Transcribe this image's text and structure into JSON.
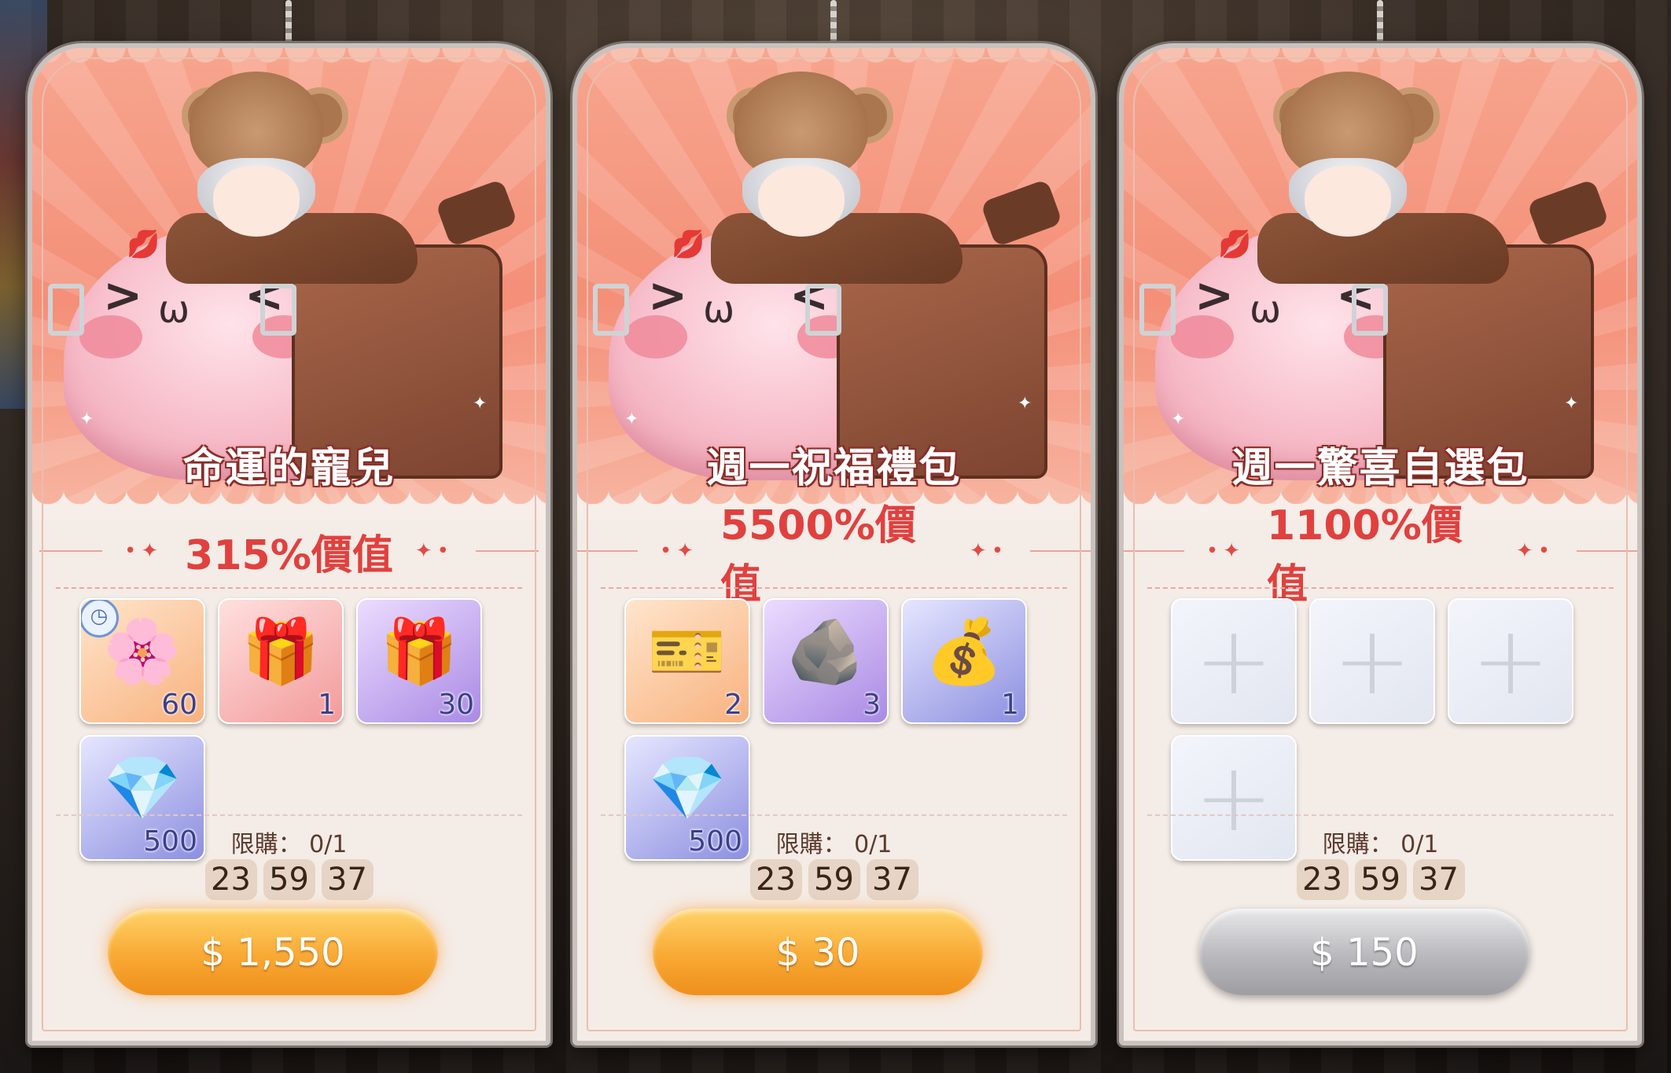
{
  "cards": [
    {
      "name": "命運的寵兒",
      "value": "315%價值",
      "items": [
        {
          "icon": "rose-petal-icon",
          "glyph": "🌸",
          "qty": "60",
          "timed": true,
          "bg": "orange"
        },
        {
          "icon": "gift-box-icon",
          "glyph": "🎁",
          "qty": "1",
          "bg": "pink"
        },
        {
          "icon": "gift-pile-icon",
          "glyph": "🎁",
          "qty": "30",
          "bg": "purple"
        },
        {
          "icon": "diamond-icon",
          "glyph": "💎",
          "qty": "500",
          "bg": "blue"
        }
      ],
      "limit": "限購： 0/1",
      "timer": [
        "23",
        "59",
        "37"
      ],
      "price": "$ 1,550",
      "enabled": true
    },
    {
      "name": "週一祝福禮包",
      "value": "5500%價值",
      "items": [
        {
          "icon": "ticket-icon",
          "glyph": "🎫",
          "qty": "2",
          "bg": "orange"
        },
        {
          "icon": "shard-icon",
          "glyph": "🪨",
          "qty": "3",
          "bg": "purple"
        },
        {
          "icon": "treasure-chest-icon",
          "glyph": "💰",
          "qty": "1",
          "bg": "blue"
        },
        {
          "icon": "diamond-icon",
          "glyph": "💎",
          "qty": "500",
          "bg": "blue"
        }
      ],
      "limit": "限購： 0/1",
      "timer": [
        "23",
        "59",
        "37"
      ],
      "price": "$ 30",
      "enabled": true
    },
    {
      "name": "週一驚喜自選包",
      "value": "1100%價值",
      "items": [
        {
          "icon": "add-slot-icon",
          "empty": true
        },
        {
          "icon": "add-slot-icon",
          "empty": true
        },
        {
          "icon": "add-slot-icon",
          "empty": true
        },
        {
          "icon": "add-slot-icon",
          "empty": true
        }
      ],
      "limit": "限購： 0/1",
      "timer": [
        "23",
        "59",
        "37"
      ],
      "price": "$ 150",
      "enabled": false
    }
  ]
}
